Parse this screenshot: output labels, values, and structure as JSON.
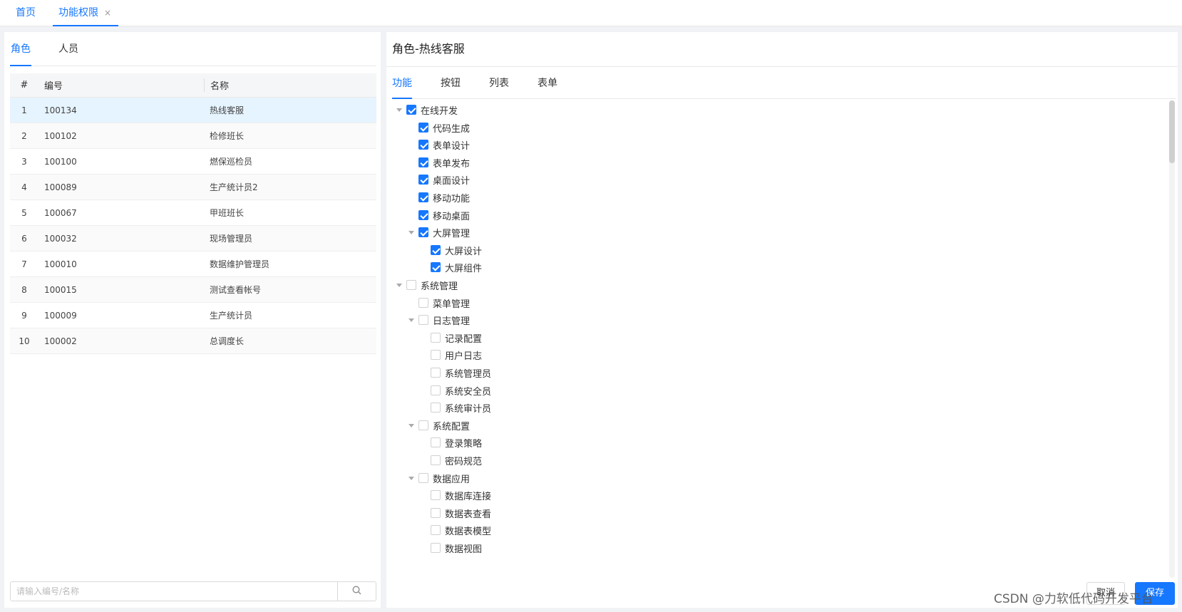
{
  "top_tabs": {
    "home": "首页",
    "active": "功能权限",
    "close": "×"
  },
  "left": {
    "tabs": [
      "角色",
      "人员"
    ],
    "columns": [
      "#",
      "编号",
      "名称"
    ],
    "rows": [
      {
        "idx": "1",
        "code": "100134",
        "name": "热线客服"
      },
      {
        "idx": "2",
        "code": "100102",
        "name": "检修班长"
      },
      {
        "idx": "3",
        "code": "100100",
        "name": "燃保巡检员"
      },
      {
        "idx": "4",
        "code": "100089",
        "name": "生产统计员2"
      },
      {
        "idx": "5",
        "code": "100067",
        "name": "甲班班长"
      },
      {
        "idx": "6",
        "code": "100032",
        "name": "现场管理员"
      },
      {
        "idx": "7",
        "code": "100010",
        "name": "数据维护管理员"
      },
      {
        "idx": "8",
        "code": "100015",
        "name": "测试查看帐号"
      },
      {
        "idx": "9",
        "code": "100009",
        "name": "生产统计员"
      },
      {
        "idx": "10",
        "code": "100002",
        "name": "总调度长"
      }
    ],
    "search_placeholder": "请输入编号/名称",
    "search_icon": "search-icon"
  },
  "right": {
    "title": "角色-热线客服",
    "tabs": [
      "功能",
      "按钮",
      "列表",
      "表单"
    ],
    "tree": [
      {
        "label": "在线开发",
        "level": 0,
        "checked": true,
        "expandable": true
      },
      {
        "label": "代码生成",
        "level": 1,
        "checked": true,
        "expandable": false
      },
      {
        "label": "表单设计",
        "level": 1,
        "checked": true,
        "expandable": false
      },
      {
        "label": "表单发布",
        "level": 1,
        "checked": true,
        "expandable": false
      },
      {
        "label": "桌面设计",
        "level": 1,
        "checked": true,
        "expandable": false
      },
      {
        "label": "移动功能",
        "level": 1,
        "checked": true,
        "expandable": false
      },
      {
        "label": "移动桌面",
        "level": 1,
        "checked": true,
        "expandable": false
      },
      {
        "label": "大屏管理",
        "level": 1,
        "checked": true,
        "expandable": true
      },
      {
        "label": "大屏设计",
        "level": 2,
        "checked": true,
        "expandable": false
      },
      {
        "label": "大屏组件",
        "level": 2,
        "checked": true,
        "expandable": false
      },
      {
        "label": "系统管理",
        "level": 0,
        "checked": false,
        "expandable": true
      },
      {
        "label": "菜单管理",
        "level": 1,
        "checked": false,
        "expandable": false
      },
      {
        "label": "日志管理",
        "level": 1,
        "checked": false,
        "expandable": true
      },
      {
        "label": "记录配置",
        "level": 2,
        "checked": false,
        "expandable": false
      },
      {
        "label": "用户日志",
        "level": 2,
        "checked": false,
        "expandable": false
      },
      {
        "label": "系统管理员",
        "level": 2,
        "checked": false,
        "expandable": false
      },
      {
        "label": "系统安全员",
        "level": 2,
        "checked": false,
        "expandable": false
      },
      {
        "label": "系统审计员",
        "level": 2,
        "checked": false,
        "expandable": false
      },
      {
        "label": "系统配置",
        "level": 1,
        "checked": false,
        "expandable": true
      },
      {
        "label": "登录策略",
        "level": 2,
        "checked": false,
        "expandable": false
      },
      {
        "label": "密码规范",
        "level": 2,
        "checked": false,
        "expandable": false
      },
      {
        "label": "数据应用",
        "level": 1,
        "checked": false,
        "expandable": true
      },
      {
        "label": "数据库连接",
        "level": 2,
        "checked": false,
        "expandable": false
      },
      {
        "label": "数据表查看",
        "level": 2,
        "checked": false,
        "expandable": false
      },
      {
        "label": "数据表模型",
        "level": 2,
        "checked": false,
        "expandable": false
      },
      {
        "label": "数据视图",
        "level": 2,
        "checked": false,
        "expandable": false
      }
    ],
    "cancel_label": "取消",
    "save_label": "保存"
  },
  "watermark": "CSDN @力软低代码开发平台",
  "colors": {
    "accent": "#1677ff",
    "selected_row": "#e6f4ff"
  }
}
